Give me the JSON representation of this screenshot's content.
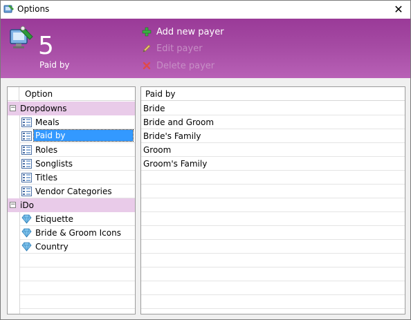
{
  "window": {
    "title": "Options",
    "close_glyph": "✕"
  },
  "banner": {
    "count": "5",
    "count_label": "Paid by",
    "actions": [
      {
        "label": "Add new payer",
        "icon": "plus-icon",
        "enabled": true
      },
      {
        "label": "Edit payer",
        "icon": "pencil-icon",
        "enabled": false
      },
      {
        "label": "Delete payer",
        "icon": "delete-x-icon",
        "enabled": false
      }
    ],
    "colors": {
      "top": "#9a3a98",
      "bottom": "#b861b6"
    }
  },
  "options": {
    "header": "Option",
    "groups": [
      {
        "label": "Dropdowns",
        "expander": "−",
        "items": [
          "Meals",
          "Paid by",
          "Roles",
          "Songlists",
          "Titles",
          "Vendor Categories"
        ]
      },
      {
        "label": "iDo",
        "expander": "−",
        "items": [
          "Etiquette",
          "Bride & Groom Icons",
          "Country"
        ]
      }
    ],
    "selected": "Paid by"
  },
  "grid": {
    "header": "Paid by",
    "rows": [
      "Bride",
      "Bride and Groom",
      "Bride's Family",
      "Groom",
      "Groom's Family"
    ]
  },
  "colors": {
    "group_bg": "#e9cbe9",
    "selection": "#3399ff"
  }
}
